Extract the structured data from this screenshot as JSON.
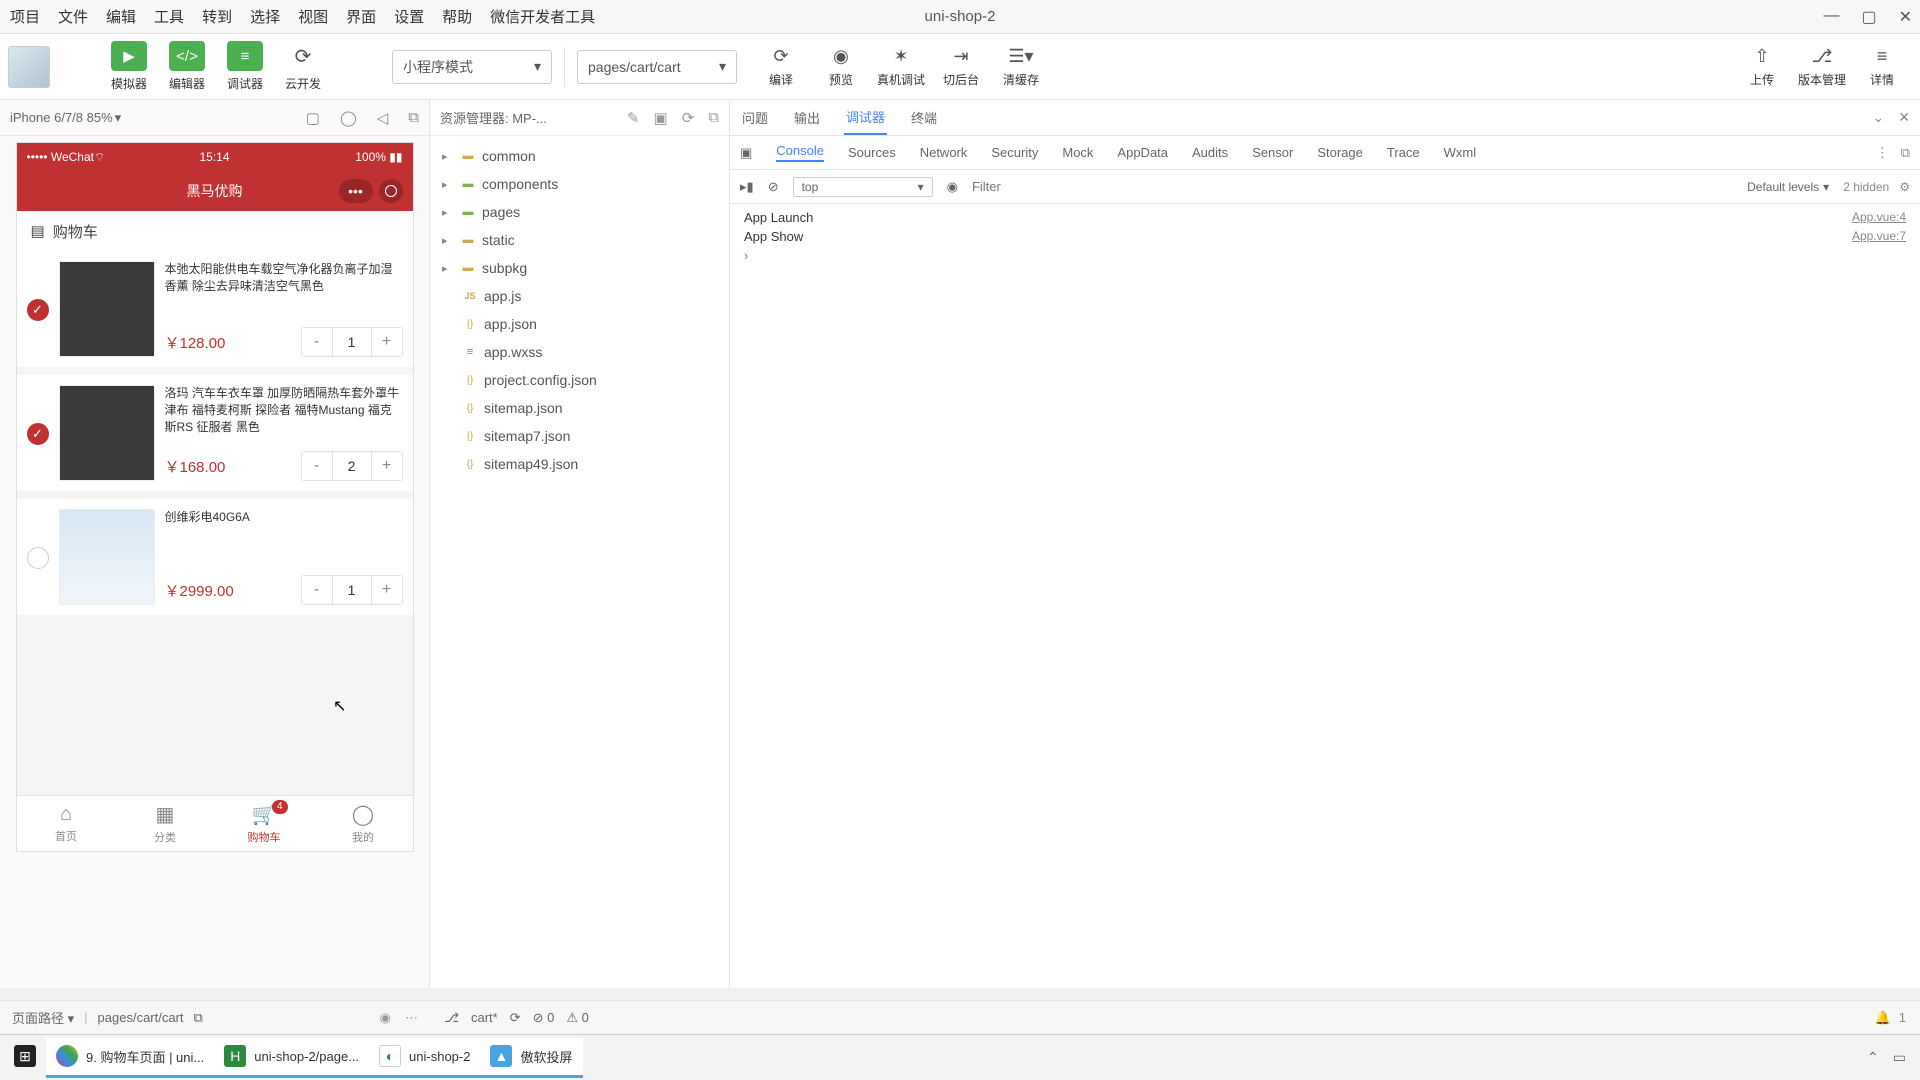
{
  "menubar": {
    "items": [
      "项目",
      "文件",
      "编辑",
      "工具",
      "转到",
      "选择",
      "视图",
      "界面",
      "设置",
      "帮助",
      "微信开发者工具"
    ],
    "title": "uni-shop-2"
  },
  "toolbar": {
    "sim": "模拟器",
    "editor": "编辑器",
    "debugger": "调试器",
    "cloud": "云开发",
    "mode": "小程序模式",
    "page_path": "pages/cart/cart",
    "compile": "编译",
    "preview": "预览",
    "real": "真机调试",
    "back": "切后台",
    "cache": "清缓存",
    "upload": "上传",
    "version": "版本管理",
    "detail": "详情"
  },
  "sim": {
    "device": "iPhone 6/7/8 85%",
    "status": {
      "carrier": "••••• WeChat",
      "wifi": "⌔",
      "time": "15:14",
      "battery": "100%"
    },
    "nav_title": "黑马优购",
    "section": "购物车",
    "items": [
      {
        "checked": true,
        "name": "本弛太阳能供电车载空气净化器负离子加湿香薰 除尘去异味清洁空气黑色",
        "price": "￥128.00",
        "qty": "1",
        "img": "dark"
      },
      {
        "checked": true,
        "name": "洛玛 汽车车衣车罩 加厚防晒隔热车套外罩牛津布 福特麦柯斯 探险者 福特Mustang 福克斯RS 征服者 黑色",
        "price": "￥168.00",
        "qty": "2",
        "img": "dark"
      },
      {
        "checked": false,
        "name": "创维彩电40G6A",
        "price": "￥2999.00",
        "qty": "1",
        "img": "tv"
      }
    ],
    "tabs": [
      "首页",
      "分类",
      "购物车",
      "我的"
    ],
    "badge": "4"
  },
  "explorer": {
    "title": "资源管理器: MP-...",
    "folders": [
      "common",
      "components",
      "pages",
      "static",
      "subpkg"
    ],
    "files": [
      "app.js",
      "app.json",
      "app.wxss",
      "project.config.json",
      "sitemap.json",
      "sitemap7.json",
      "sitemap49.json"
    ]
  },
  "devtools": {
    "top_tabs": [
      "问题",
      "输出",
      "调试器",
      "终端"
    ],
    "sub_tabs": [
      "Console",
      "Sources",
      "Network",
      "Security",
      "Mock",
      "AppData",
      "Audits",
      "Sensor",
      "Storage",
      "Trace",
      "Wxml"
    ],
    "context": "top",
    "filter_placeholder": "Filter",
    "levels": "Default levels",
    "hidden": "2 hidden",
    "logs": [
      {
        "msg": "App Launch",
        "src": "App.vue:4"
      },
      {
        "msg": "App Show",
        "src": "App.vue:7"
      }
    ]
  },
  "status_sim": {
    "label": "页面路径",
    "path": "pages/cart/cart"
  },
  "status_exp": {
    "branch": "cart*",
    "err": "0",
    "warn": "0",
    "notif": "1"
  },
  "taskbar": {
    "items": [
      {
        "label": "9. 购物车页面 | uni...",
        "color": "#fff"
      },
      {
        "label": "uni-shop-2/page...",
        "color": "#2b8a3e"
      },
      {
        "label": "uni-shop-2",
        "color": "#2b8a3e"
      },
      {
        "label": "傲软投屏",
        "color": "#4aa3df"
      }
    ]
  }
}
